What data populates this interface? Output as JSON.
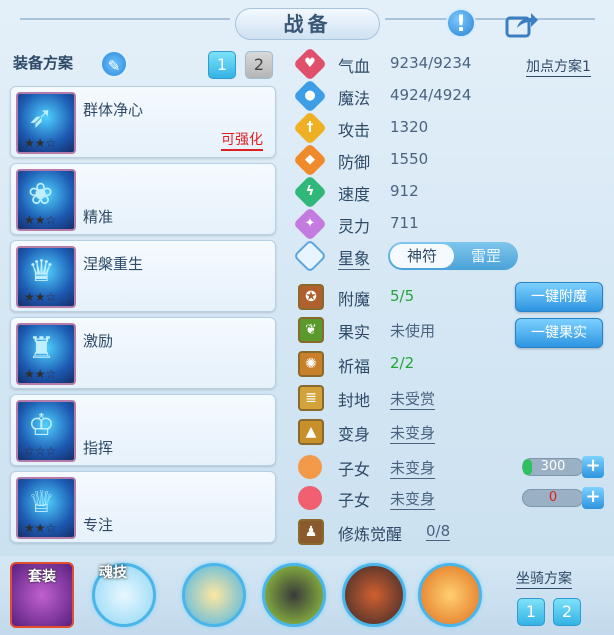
{
  "title": "战备",
  "equip_scheme": {
    "label": "装备方案",
    "tabs": [
      "1",
      "2"
    ],
    "active": "1"
  },
  "skills": [
    {
      "name": "群体净心",
      "tag": "可强化",
      "stars": "★★☆"
    },
    {
      "name": "精准",
      "tag": "",
      "stars": "★★☆"
    },
    {
      "name": "涅槃重生",
      "tag": "",
      "stars": "★★☆"
    },
    {
      "name": "激励",
      "tag": "",
      "stars": "★★☆"
    },
    {
      "name": "指挥",
      "tag": "",
      "stars": "☆☆☆"
    },
    {
      "name": "专注",
      "tag": "",
      "stars": "★★☆"
    }
  ],
  "attributes": [
    {
      "label": "气血",
      "value": "9234/9234",
      "color": "#e0506a",
      "glyph": "♥"
    },
    {
      "label": "魔法",
      "value": "4924/4924",
      "color": "#3d9de6",
      "glyph": "●"
    },
    {
      "label": "攻击",
      "value": "1320",
      "color": "#f0b023",
      "glyph": "†"
    },
    {
      "label": "防御",
      "value": "1550",
      "color": "#f08a2a",
      "glyph": "◆"
    },
    {
      "label": "速度",
      "value": "912",
      "color": "#2fb87a",
      "glyph": "ϟ"
    },
    {
      "label": "灵力",
      "value": "711",
      "color": "#c47be0",
      "glyph": "✦"
    }
  ],
  "points_scheme": "加点方案1",
  "star_sign": {
    "label": "星象",
    "options": [
      "神符",
      "雷罡"
    ],
    "active": "神符"
  },
  "enchant": {
    "label": "附魔",
    "value": "5/5",
    "button": "一键附魔"
  },
  "fruit": {
    "label": "果实",
    "value": "未使用",
    "button": "一键果实"
  },
  "blessing": {
    "label": "祈福",
    "value": "2/2"
  },
  "fief": {
    "label": "封地",
    "value": "未受赏"
  },
  "transform": {
    "label": "变身",
    "value": "未变身"
  },
  "children": [
    {
      "label": "子女",
      "value": "未变身",
      "bar_value": "300",
      "bar_fill": 0.15,
      "bar_color": "#2fc060"
    },
    {
      "label": "子女",
      "value": "未变身",
      "bar_value": "0",
      "bar_fill": 0,
      "bar_color": "#e02020"
    }
  ],
  "cultivation": {
    "label": "修炼觉醒",
    "value": "0/8"
  },
  "bottom": {
    "set_label": "套装",
    "soul_label": "魂技",
    "mount_scheme": "坐骑方案",
    "mount_tabs": [
      "1",
      "2"
    ]
  }
}
